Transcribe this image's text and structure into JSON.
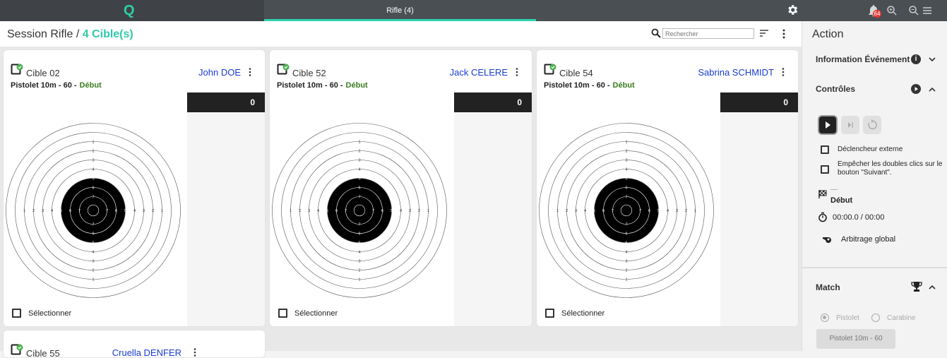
{
  "topbar": {
    "logo": "Q",
    "tab_label": "Rifle (4)",
    "notifications": "64",
    "accent_color": "#2fd3b0"
  },
  "header": {
    "title_prefix": "Session Rifle /",
    "title_count": "4 Cible(s)",
    "search_placeholder": "Rechercher"
  },
  "cards": [
    {
      "cible": "Cible 02",
      "shooter": "John DOE",
      "event": "Pistolet 10m - 60 -",
      "status": "Début",
      "score": "0",
      "select_label": "Sélectionner"
    },
    {
      "cible": "Cible 52",
      "shooter": "Jack CELERE",
      "event": "Pistolet 10m - 60 -",
      "status": "Début",
      "score": "0",
      "select_label": "Sélectionner"
    },
    {
      "cible": "Cible 54",
      "shooter": "Sabrina SCHMIDT",
      "event": "Pistolet 10m - 60 -",
      "status": "Début",
      "score": "0",
      "select_label": "Sélectionner"
    },
    {
      "cible": "Cible 55",
      "shooter": "Cruella DENFER"
    }
  ],
  "target_rings": [
    "1",
    "2",
    "3",
    "4",
    "5",
    "6",
    "7",
    "8",
    "7",
    "6",
    "5",
    "4",
    "3",
    "2",
    "1"
  ],
  "sidebar": {
    "title": "Action",
    "info_section": "Information Événement",
    "controls_section": "Contrôles",
    "external_trigger": "Déclencheur externe",
    "prevent_double": "Empêcher les doubles clics sur le bouton \"Suivant\".",
    "dash": "—",
    "phase": "Début",
    "timer": "00:00.0 / 00:00",
    "arbitration": "Arbitrage global",
    "match_section": "Match",
    "radio_pistol": "Pistolet",
    "radio_rifle": "Carabine",
    "match_button": "Pistolet 10m - 60"
  }
}
